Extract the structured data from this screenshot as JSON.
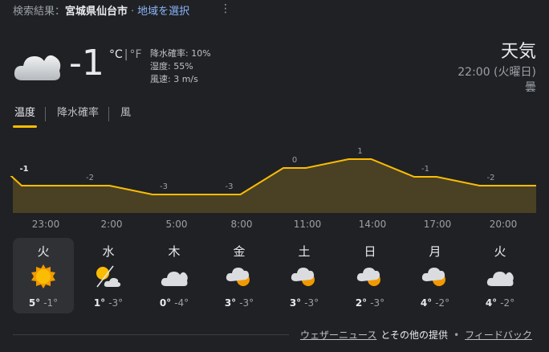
{
  "search": {
    "prefix": "検索結果：",
    "location": "宮城県仙台市",
    "separator": "·",
    "change_location": "地域を選択",
    "more_icon": "more-vert-icon"
  },
  "current": {
    "icon": "cloudy-icon",
    "temp": "-1",
    "unit_c": "°C",
    "unit_sep": "|",
    "unit_f": "°F",
    "precip": "降水確率: 10%",
    "humidity": "湿度: 55%",
    "wind": "風速: 3 m/s",
    "title": "天気",
    "time": "22:00 (火曜日)",
    "condition": "曇"
  },
  "tabs": [
    {
      "label": "温度",
      "selected": true
    },
    {
      "label": "降水確率",
      "selected": false
    },
    {
      "label": "風",
      "selected": false
    }
  ],
  "chart_data": {
    "type": "area",
    "x": [
      "22:00",
      "23:00",
      "2:00",
      "5:00",
      "8:00",
      "11:00",
      "14:00",
      "17:00",
      "20:00",
      "22:00"
    ],
    "values": [
      -1,
      -2,
      -2,
      -3,
      -3,
      0,
      1,
      -1,
      -2,
      -2
    ],
    "labels": [
      {
        "i": 0,
        "text": "-1"
      },
      {
        "i": 1,
        "text": "-2"
      },
      {
        "i": 3,
        "text": "-3"
      },
      {
        "i": 4,
        "text": "-3"
      },
      {
        "i": 5,
        "text": "0"
      },
      {
        "i": 6,
        "text": "1"
      },
      {
        "i": 7,
        "text": "-1"
      },
      {
        "i": 8,
        "text": "-2"
      }
    ],
    "xtick_labels": [
      "23:00",
      "2:00",
      "5:00",
      "8:00",
      "11:00",
      "14:00",
      "17:00",
      "20:00"
    ],
    "line_color": "#fbbc04",
    "fill_color": "#4a4125"
  },
  "days": [
    {
      "name": "火",
      "icon": "sunny-icon",
      "hi": "5°",
      "lo": "-1°",
      "selected": true
    },
    {
      "name": "水",
      "icon": "sun-cloud-split-icon",
      "hi": "1°",
      "lo": "-3°",
      "selected": false
    },
    {
      "name": "木",
      "icon": "cloudy-icon",
      "hi": "0°",
      "lo": "-4°",
      "selected": false
    },
    {
      "name": "金",
      "icon": "partly-cloudy-icon",
      "hi": "3°",
      "lo": "-3°",
      "selected": false
    },
    {
      "name": "土",
      "icon": "partly-cloudy-icon",
      "hi": "3°",
      "lo": "-3°",
      "selected": false
    },
    {
      "name": "日",
      "icon": "partly-cloudy-icon",
      "hi": "2°",
      "lo": "-3°",
      "selected": false
    },
    {
      "name": "月",
      "icon": "partly-cloudy-icon",
      "hi": "4°",
      "lo": "-2°",
      "selected": false
    },
    {
      "name": "火",
      "icon": "cloudy-icon",
      "hi": "4°",
      "lo": "-2°",
      "selected": false
    }
  ],
  "footer": {
    "source": "ウェザーニュース",
    "source_suffix": "とその他の提供",
    "dot": "•",
    "feedback": "フィードバック"
  }
}
